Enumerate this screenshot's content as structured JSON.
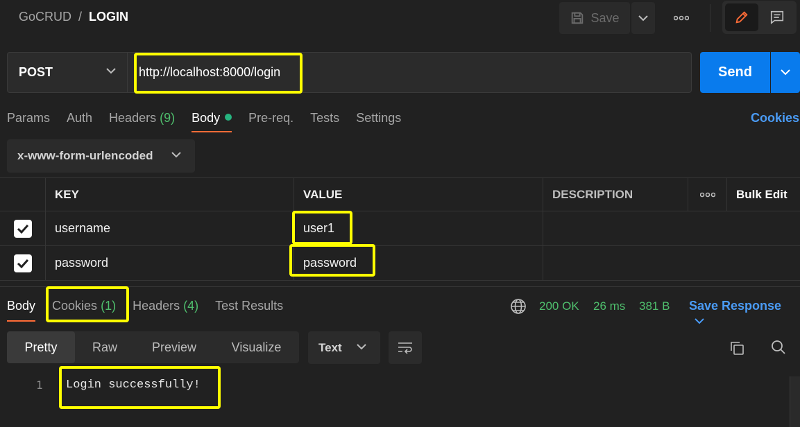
{
  "breadcrumb": {
    "app": "GoCRUD",
    "separator": "/",
    "current": "LOGIN"
  },
  "toolbar": {
    "save_label": "Save",
    "more_label": "ooo"
  },
  "request": {
    "method": "POST",
    "url": "http://localhost:8000/login",
    "send_label": "Send"
  },
  "request_tabs": [
    {
      "label": "Params"
    },
    {
      "label": "Auth"
    },
    {
      "label": "Headers",
      "count": "(9)"
    },
    {
      "label": "Body"
    },
    {
      "label": "Pre-req."
    },
    {
      "label": "Tests"
    },
    {
      "label": "Settings"
    }
  ],
  "cookies_link": "Cookies",
  "body_type": "x-www-form-urlencoded",
  "table": {
    "headers": {
      "key": "KEY",
      "value": "VALUE",
      "description": "DESCRIPTION",
      "more": "ooo",
      "bulk": "Bulk Edit"
    },
    "rows": [
      {
        "key": "username",
        "value": "user1",
        "description": ""
      },
      {
        "key": "password",
        "value": "password",
        "description": ""
      }
    ]
  },
  "response_tabs": [
    {
      "label": "Body"
    },
    {
      "label": "Cookies",
      "count": "(1)"
    },
    {
      "label": "Headers",
      "count": "(4)"
    },
    {
      "label": "Test Results"
    }
  ],
  "status": {
    "code": "200 OK",
    "time": "26 ms",
    "size": "381 B"
  },
  "save_response": "Save Response",
  "view_tabs": [
    "Pretty",
    "Raw",
    "Preview",
    "Visualize"
  ],
  "format": "Text",
  "response_body": {
    "line_number": "1",
    "text": "Login successfully!"
  },
  "colors": {
    "accent": "#ff6c37",
    "send": "#097bed",
    "link": "#4a9bf5",
    "success": "#4fbf6d",
    "highlight": "#ffff00"
  }
}
